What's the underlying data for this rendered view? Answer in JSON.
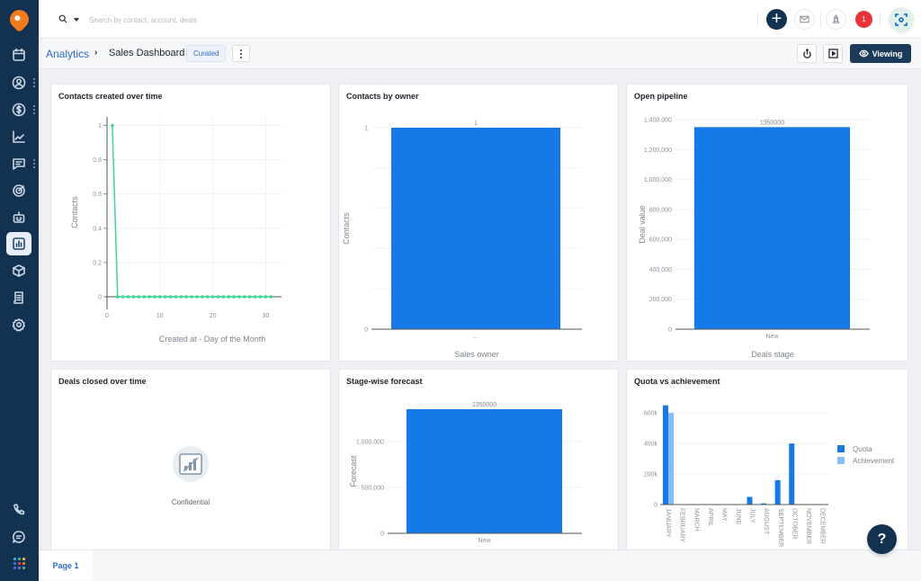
{
  "header": {
    "search_placeholder": "Search by contact, account, deals",
    "notification_count": "1",
    "icons": [
      "search-icon",
      "add-icon",
      "mail-icon",
      "rocket-icon",
      "scan-icon"
    ]
  },
  "sidebar": {
    "items": [
      {
        "name": "calendar",
        "has_menu": false
      },
      {
        "name": "contacts",
        "has_menu": true
      },
      {
        "name": "deals",
        "has_menu": true
      },
      {
        "name": "reports-trend",
        "has_menu": false
      },
      {
        "name": "conversations",
        "has_menu": true
      },
      {
        "name": "goals",
        "has_menu": false
      },
      {
        "name": "bot",
        "has_menu": false
      },
      {
        "name": "analytics",
        "has_menu": false,
        "active": true
      },
      {
        "name": "products",
        "has_menu": false
      },
      {
        "name": "documents",
        "has_menu": false
      },
      {
        "name": "settings",
        "has_menu": false
      },
      {
        "name": "phone",
        "has_menu": false
      },
      {
        "name": "chat",
        "has_menu": false
      }
    ],
    "apps_grid_colors": [
      "#2bb5e8",
      "#3ec37a",
      "#f5b82e",
      "#2f7de1",
      "#e8443a",
      "#f07c1b",
      "#5a6be0",
      "#9b59d0",
      "#3ec37a"
    ]
  },
  "subheader": {
    "breadcrumb_root": "Analytics",
    "breadcrumb_sep": "›",
    "title": "Sales Dashboard",
    "badge": "Curated",
    "viewing_label": "Viewing"
  },
  "cards": {
    "contacts_over_time": {
      "title": "Contacts created over time"
    },
    "contacts_by_owner": {
      "title": "Contacts by owner"
    },
    "open_pipeline": {
      "title": "Open pipeline"
    },
    "deals_closed": {
      "title": "Deals closed over time",
      "confidential_label": "Confidential"
    },
    "stage_forecast": {
      "title": "Stage-wise forecast"
    },
    "quota_vs_achievement": {
      "title": "Quota vs achievement"
    }
  },
  "footer": {
    "page_tab": "Page 1"
  },
  "help_label": "?",
  "colors": {
    "primary_bar": "#1679e8",
    "achievement_bar": "#86bcf7",
    "line_green": "#3dd68c",
    "sidebar_bg": "#133150"
  },
  "chart_data": [
    {
      "id": "contacts_over_time",
      "type": "line",
      "title": "Contacts created over time",
      "xlabel": "Created at - Day of the Month",
      "ylabel": "Contacts",
      "x": [
        1,
        2,
        3,
        4,
        5,
        6,
        7,
        8,
        9,
        10,
        11,
        12,
        13,
        14,
        15,
        16,
        17,
        18,
        19,
        20,
        21,
        22,
        23,
        24,
        25,
        26,
        27,
        28,
        29,
        30,
        31
      ],
      "values": [
        1,
        0,
        0,
        0,
        0,
        0,
        0,
        0,
        0,
        0,
        0,
        0,
        0,
        0,
        0,
        0,
        0,
        0,
        0,
        0,
        0,
        0,
        0,
        0,
        0,
        0,
        0,
        0,
        0,
        0,
        0
      ],
      "xlim": [
        0,
        33
      ],
      "ylim": [
        0,
        1.05
      ],
      "xticks": [
        0,
        10,
        20,
        30
      ],
      "yticks": [
        0,
        0.2,
        0.4,
        0.6,
        0.8,
        1
      ],
      "ytick_labels": [
        "0",
        "0.2",
        "0.4",
        "0.6",
        "0.8",
        "1"
      ],
      "grid": true
    },
    {
      "id": "contacts_by_owner",
      "type": "bar",
      "title": "Contacts by owner",
      "xlabel": "Sales owner",
      "ylabel": "Contacts",
      "categories": [
        "..."
      ],
      "values": [
        1
      ],
      "data_labels": [
        "1"
      ],
      "ylim": [
        0,
        1
      ],
      "yticks": [
        0,
        1
      ],
      "ytick_labels": [
        "0",
        "1"
      ],
      "grid": true
    },
    {
      "id": "open_pipeline",
      "type": "bar",
      "title": "Open pipeline",
      "xlabel": "Deals stage",
      "ylabel": "Deal value",
      "categories": [
        "New"
      ],
      "values": [
        1350000
      ],
      "data_labels": [
        "1350000"
      ],
      "ylim": [
        0,
        1400000
      ],
      "yticks": [
        0,
        200000,
        400000,
        600000,
        800000,
        1000000,
        1200000,
        1400000
      ],
      "ytick_labels": [
        "0",
        "200,000",
        "400,000",
        "600,000",
        "800,000",
        "1,000,000",
        "1,200,000",
        "1,400,000"
      ],
      "grid": true
    },
    {
      "id": "stage_forecast",
      "type": "bar",
      "title": "Stage-wise forecast",
      "xlabel": "",
      "ylabel": "Forecast",
      "categories": [
        "New"
      ],
      "values": [
        1350000
      ],
      "data_labels": [
        "1350000"
      ],
      "ylim": [
        0,
        1350000
      ],
      "yticks": [
        0,
        500000,
        1000000
      ],
      "ytick_labels": [
        "0",
        "500,000",
        "1,000,000"
      ],
      "grid": true
    },
    {
      "id": "quota_vs_achievement",
      "type": "bar",
      "title": "Quota vs achievement",
      "categories": [
        "JANUARY",
        "FEBRUARY",
        "MARCH",
        "APRIL",
        "MAY",
        "JUNE",
        "JULY",
        "AUGUST",
        "SEPTEMBER",
        "OCTOBER",
        "NOVEMBER",
        "DECEMBER"
      ],
      "series": [
        {
          "name": "Quota",
          "values": [
            650000,
            0,
            0,
            0,
            0,
            0,
            50000,
            8000,
            160000,
            400000,
            0,
            0
          ]
        },
        {
          "name": "Achievement",
          "values": [
            600000,
            0,
            0,
            0,
            0,
            0,
            0,
            0,
            0,
            0,
            0,
            0
          ]
        }
      ],
      "ylim": [
        0,
        660000
      ],
      "yticks": [
        0,
        200000,
        400000,
        600000
      ],
      "ytick_labels": [
        "0",
        "200k",
        "400k",
        "600k"
      ],
      "legend": "right",
      "grid": true
    }
  ]
}
